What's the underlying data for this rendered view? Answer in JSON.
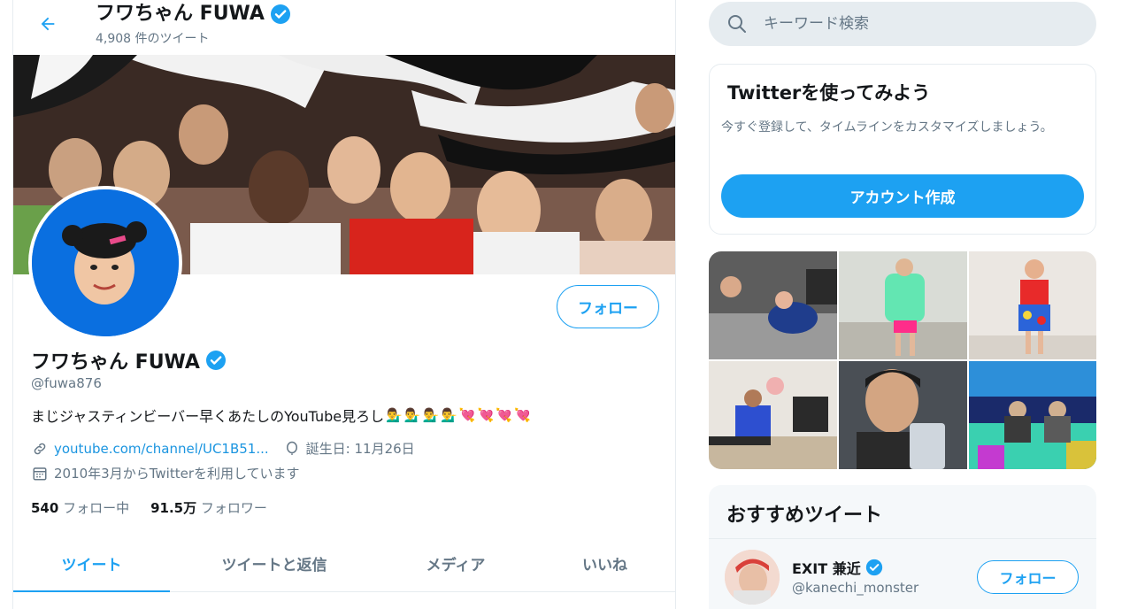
{
  "header": {
    "name": "フワちゃん FUWA",
    "tweet_count": "4,908 件のツイート"
  },
  "profile": {
    "name": "フワちゃん FUWA",
    "handle": "@fuwa876",
    "bio": "まじジャスティンビーバー早くあたしのYouTube見ろし",
    "bio_emojis": [
      "💁‍♂️",
      "💁‍♂️",
      "💁‍♂️",
      "💁‍♂️",
      "💘",
      "💘",
      "💘",
      "💘"
    ],
    "url": "youtube.com/channel/UC1B51...",
    "birthday": "誕生日: 11月26日",
    "joined": "2010年3月からTwitterを利用しています",
    "following_count": "540",
    "following_label": "フォロー中",
    "followers_count": "91.5万",
    "followers_label": "フォロワー",
    "follow_button": "フォロー"
  },
  "tabs": [
    "ツイート",
    "ツイートと返信",
    "メディア",
    "いいね"
  ],
  "search": {
    "placeholder": "キーワード検索"
  },
  "signup": {
    "title": "Twitterを使ってみよう",
    "description": "今すぐ登録して、タイムラインをカスタマイズしましょう。",
    "button": "アカウント作成"
  },
  "recommended": {
    "title": "おすすめツイート",
    "users": [
      {
        "name": "EXIT 兼近",
        "handle": "@kanechi_monster",
        "button": "フォロー"
      }
    ]
  },
  "colors": {
    "accent": "#1da1f2",
    "secondary_text": "#657786",
    "verified": "#1da1f2",
    "avatar_bg": "#0a6fe0"
  },
  "icons": {
    "back": "arrow-left-icon",
    "verified": "verified-badge-icon",
    "link": "link-icon",
    "birthday": "balloon-icon",
    "calendar": "calendar-icon",
    "search": "search-icon"
  }
}
